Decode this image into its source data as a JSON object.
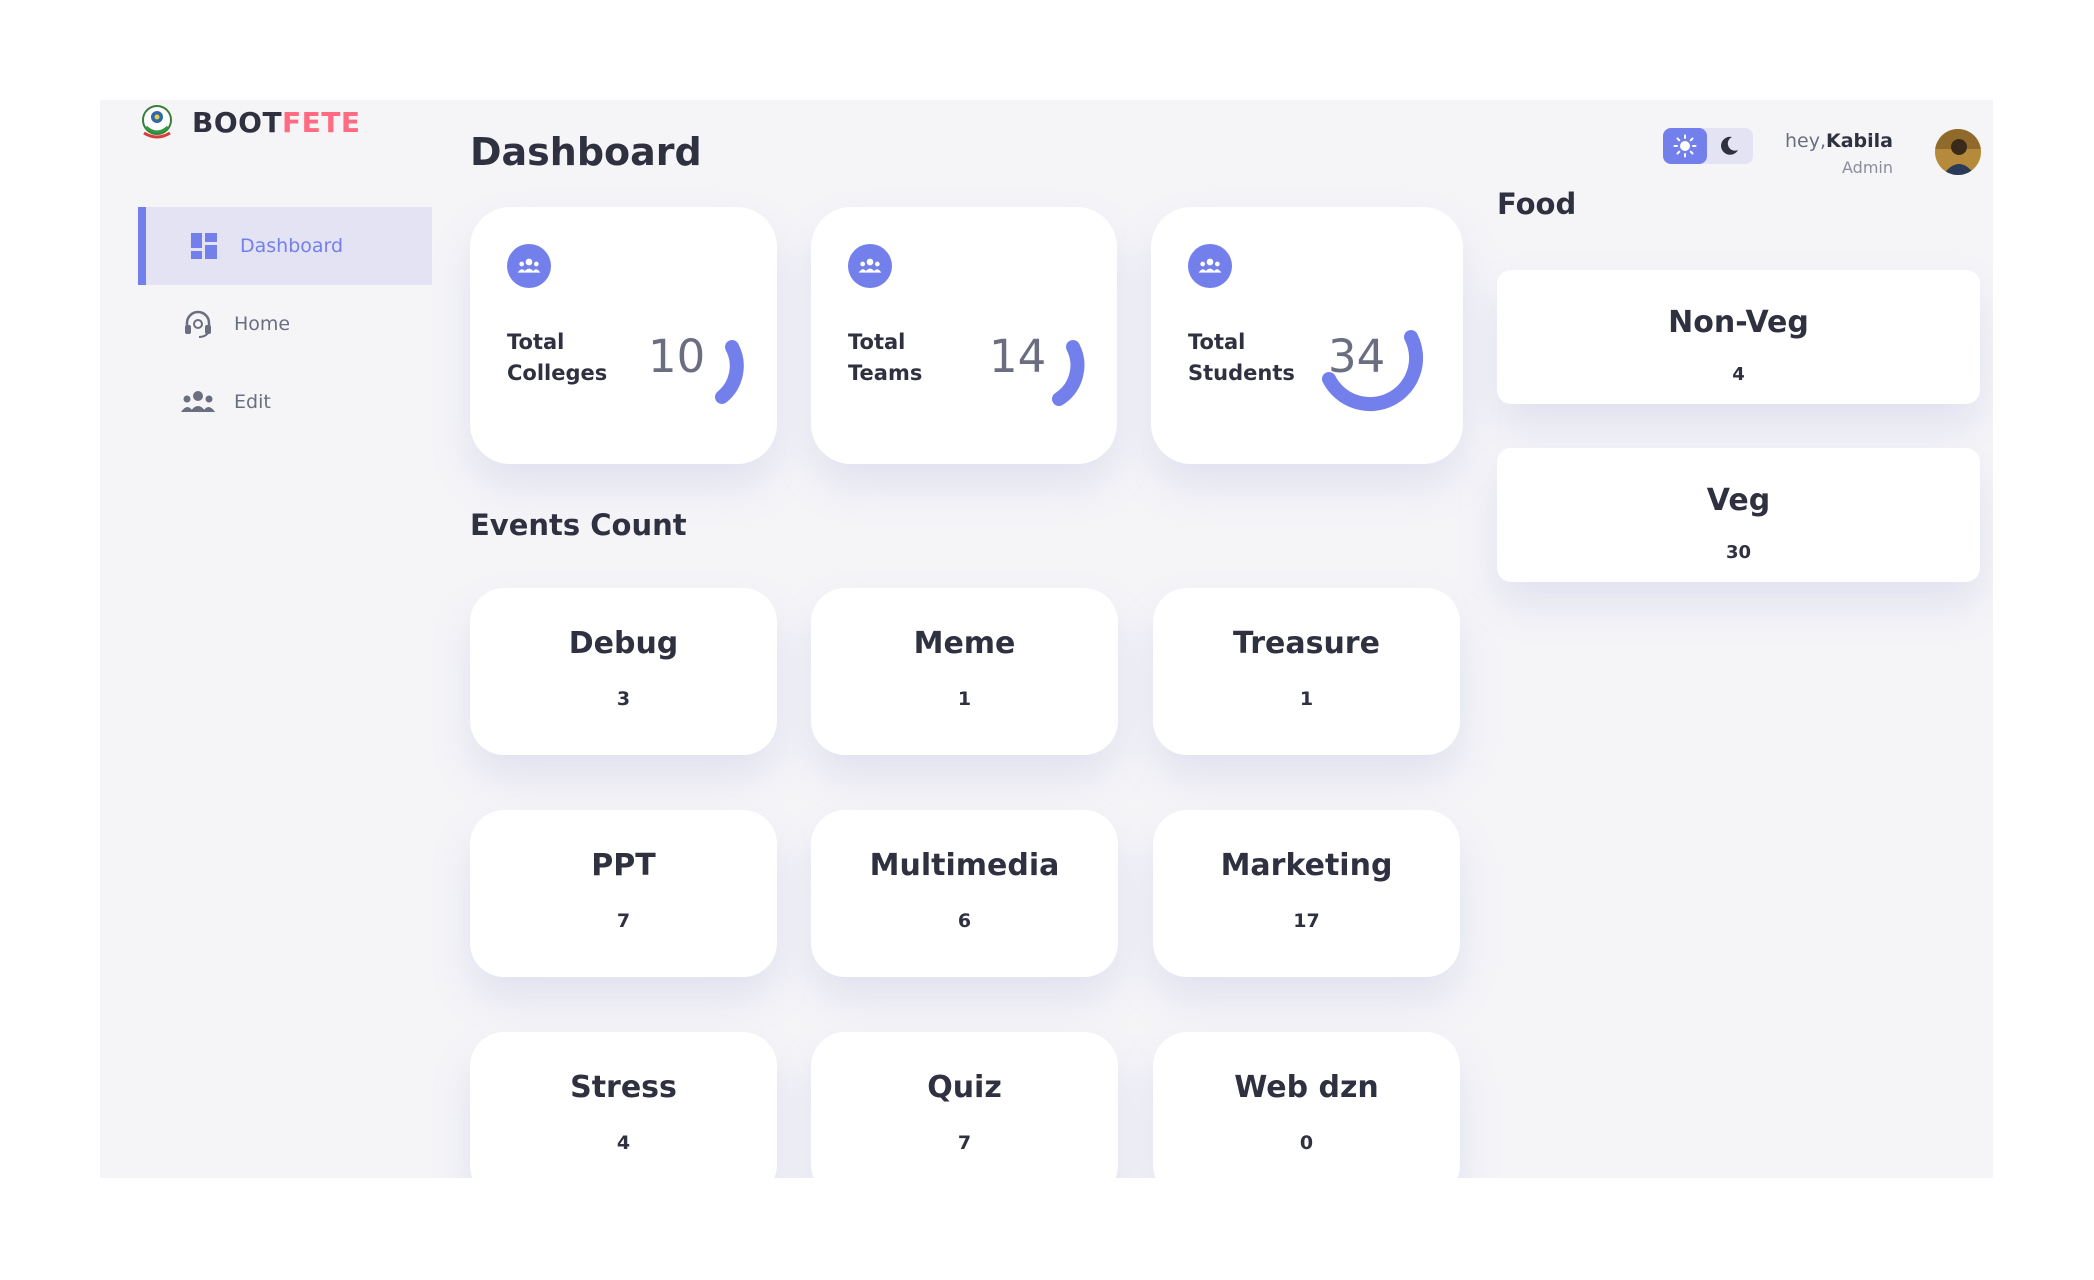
{
  "brand": {
    "part1": "BOOT",
    "part2": "FETE",
    "accent": "#ff6b81"
  },
  "colors": {
    "primary": "#7380ec",
    "dark": "#2f3140",
    "background": "#f5f5f8"
  },
  "sidebar": {
    "items": [
      {
        "label": "Dashboard",
        "icon": "dashboard-grid-icon",
        "active": true
      },
      {
        "label": "Home",
        "icon": "headset-icon",
        "active": false
      },
      {
        "label": "Edit",
        "icon": "group-icon",
        "active": false
      }
    ]
  },
  "main": {
    "title": "Dashboard",
    "stats": [
      {
        "label": "Total Colleges",
        "value": "10",
        "icon": "group-icon"
      },
      {
        "label": "Total Teams",
        "value": "14",
        "icon": "group-icon"
      },
      {
        "label": "Total Students",
        "value": "34",
        "icon": "group-icon"
      }
    ],
    "events_title": "Events Count",
    "events": [
      {
        "name": "Debug",
        "count": "3"
      },
      {
        "name": "Meme",
        "count": "1"
      },
      {
        "name": "Treasure",
        "count": "1"
      },
      {
        "name": "PPT",
        "count": "7"
      },
      {
        "name": "Multimedia",
        "count": "6"
      },
      {
        "name": "Marketing",
        "count": "17"
      },
      {
        "name": "Stress",
        "count": "4"
      },
      {
        "name": "Quiz",
        "count": "7"
      },
      {
        "name": "Web dzn",
        "count": "0"
      }
    ]
  },
  "header": {
    "greeting_prefix": "hey,",
    "user_name": "Kabila",
    "role": "Admin",
    "theme_light_icon": "sun-icon",
    "theme_dark_icon": "moon-icon"
  },
  "food": {
    "title": "Food",
    "items": [
      {
        "name": "Non-Veg",
        "count": "4"
      },
      {
        "name": "Veg",
        "count": "30"
      }
    ]
  }
}
